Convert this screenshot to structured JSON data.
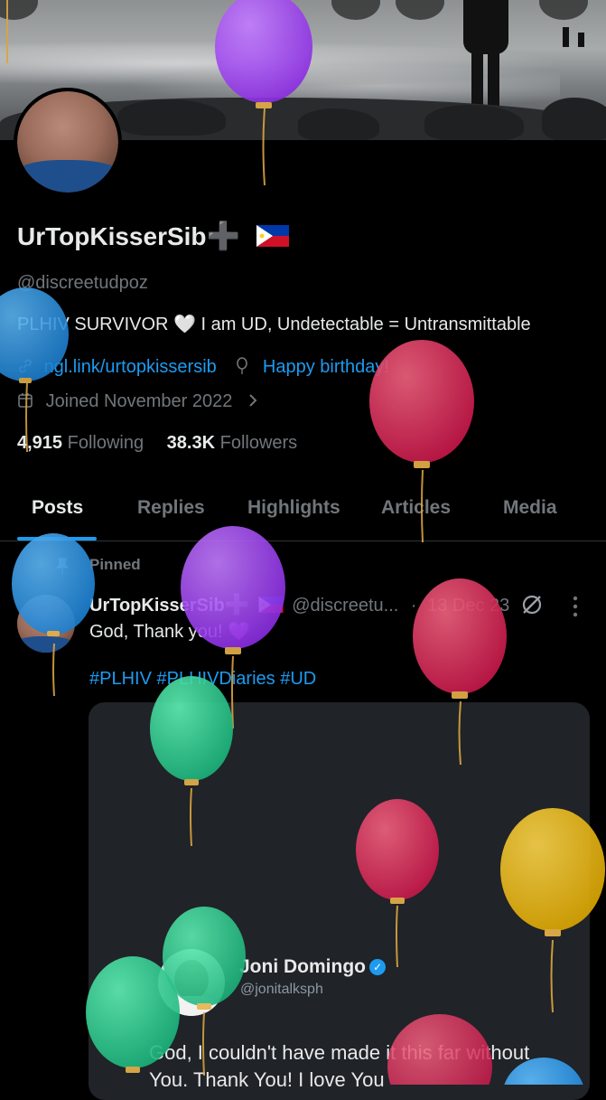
{
  "profile": {
    "display_name": "UrTopKisserSib",
    "name_plus": "➕",
    "handle": "@discreetudpoz",
    "bio": "PLHIV SURVIVOR 🤍 I am UD, Undetectable = Untransmittable",
    "link_text": "ngl.link/urtopkissersib",
    "birthday_text": "Happy birthday!",
    "joined_text": "Joined November 2022",
    "following_count": "4,915",
    "following_label": "Following",
    "followers_count": "38.3K",
    "followers_label": "Followers"
  },
  "tabs": [
    {
      "label": "Posts",
      "active": true
    },
    {
      "label": "Replies",
      "active": false
    },
    {
      "label": "Highlights",
      "active": false
    },
    {
      "label": "Articles",
      "active": false
    },
    {
      "label": "Media",
      "active": false
    }
  ],
  "pinned_post": {
    "pinned_label": "Pinned",
    "author": "UrTopKisserSib",
    "author_handle": "@discreetu...",
    "separator": "·",
    "date": "13 Dec 23",
    "text": "God, Thank you! 💜",
    "hashtags": "#PLHIV #PLHIVDiaries #UD"
  },
  "quoted": {
    "name": "Joni Domingo",
    "handle": "@jonitalksph",
    "text": "God, I couldn't have made it this far without You. Thank You! I love You"
  },
  "colors": {
    "background": "#000000",
    "accent": "#1d9bf0",
    "secondary_text": "#71767b",
    "primary_text": "#e7e9ea"
  },
  "icons": [
    "link-icon",
    "balloon-icon",
    "calendar-icon",
    "chevron-right-icon",
    "pin-icon",
    "grok-icon",
    "more-icon",
    "verified-badge-icon",
    "flag-ph-icon"
  ]
}
